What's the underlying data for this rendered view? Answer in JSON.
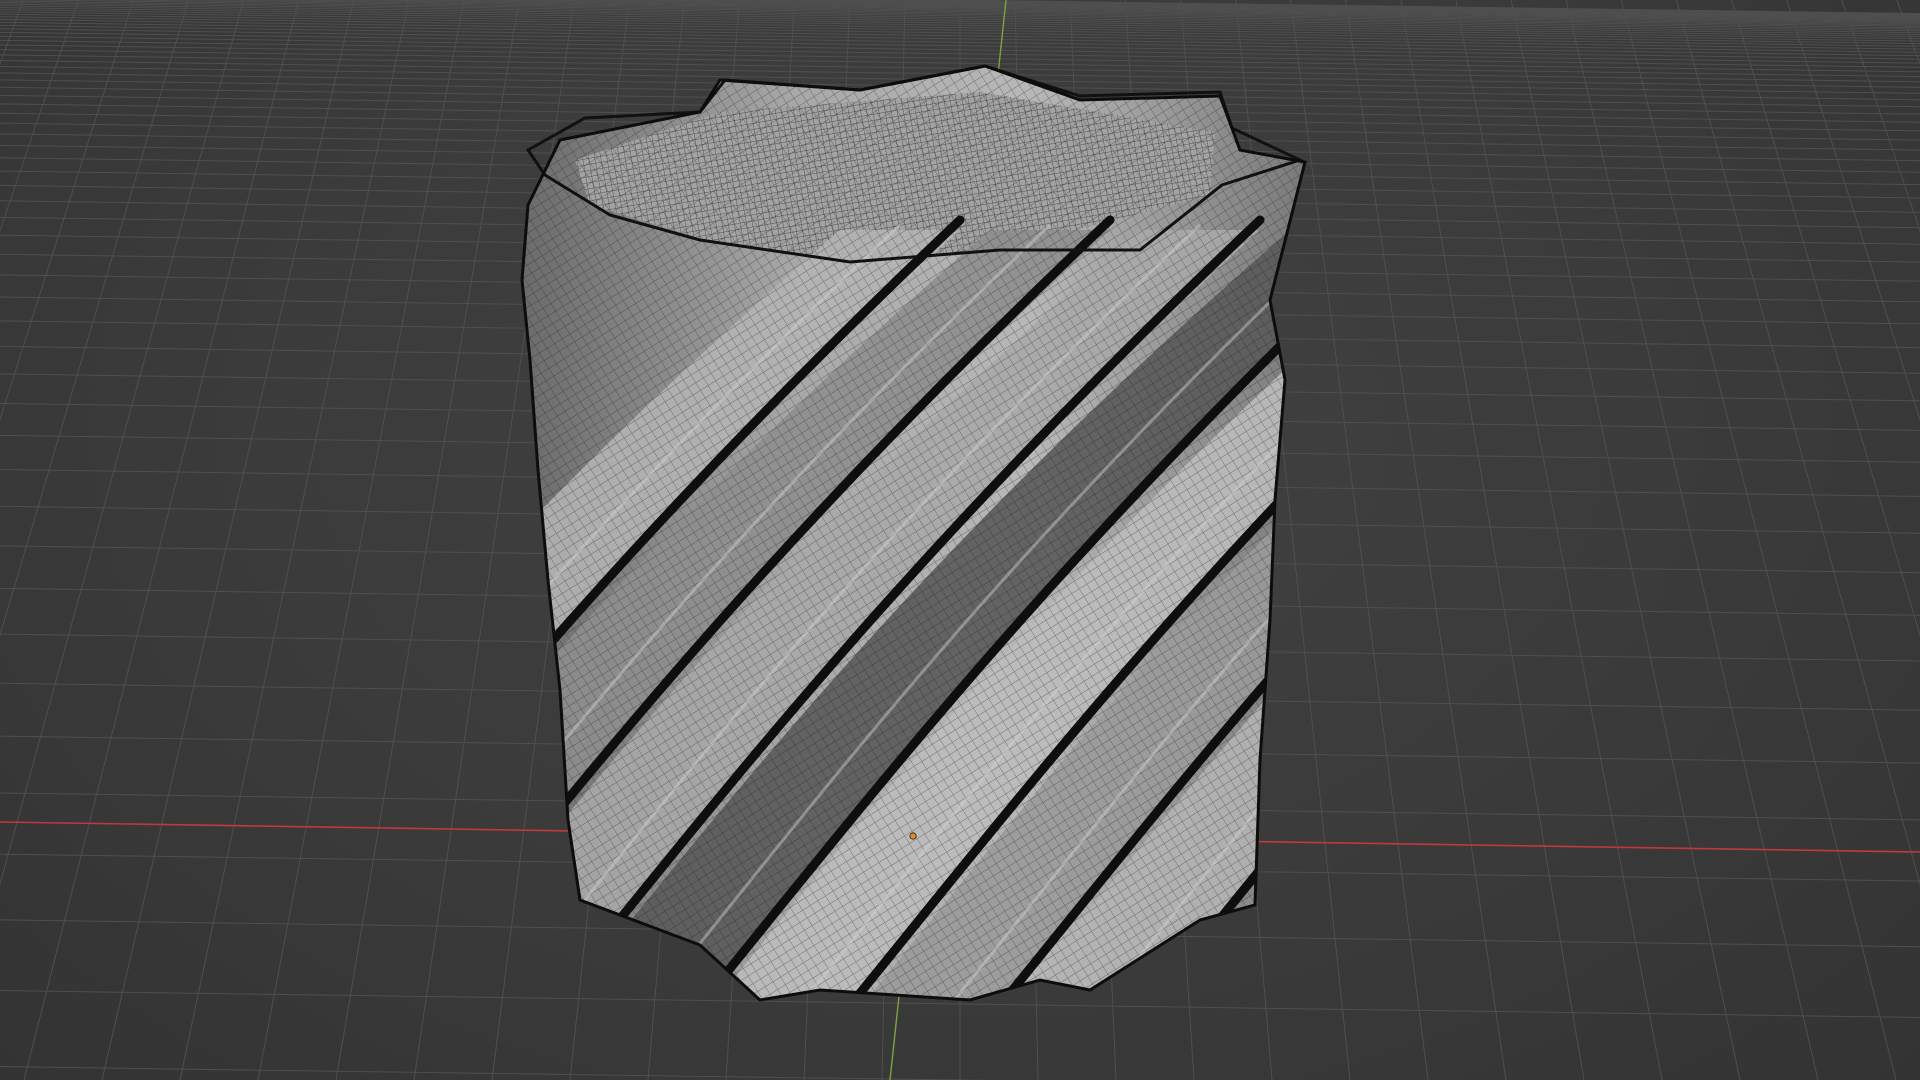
{
  "viewport": {
    "background_color": "#3d3d3d",
    "grid_color": "#4f4f4f",
    "x_axis_color": "#c0393b",
    "y_axis_color": "#7fa33a",
    "origin_color": "#e08a1e"
  },
  "object": {
    "icon": "twisted-vase-mesh",
    "shading": "solid-with-wireframe",
    "surface_light": "#b4b4b4",
    "surface_mid": "#8e8e8e",
    "surface_dark": "#5a5a5a",
    "groove_color": "#0e0e0e",
    "wire_color": "#1a1a1a",
    "interior_color": "#9c9c9c"
  }
}
